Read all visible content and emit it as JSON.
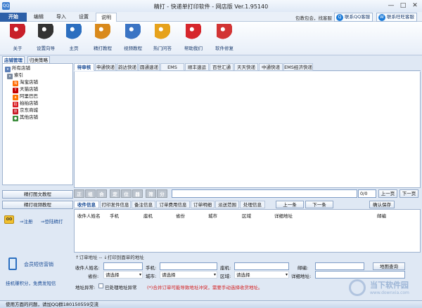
{
  "window": {
    "logo": "QQ",
    "title": "精打 - 快递单打印软件 - 网店版 Ver.1.95140",
    "controls": [
      "—",
      "□",
      "✕"
    ]
  },
  "menu": {
    "start": "开始",
    "tabs": [
      "编辑",
      "导入",
      "设置",
      "说明"
    ],
    "active": "说明"
  },
  "support": {
    "text": "包教包会，找客服",
    "qq_btn": "联系QQ客服",
    "wangwang_btn": "联系旺旺客服"
  },
  "ribbon": [
    {
      "label": "关于",
      "icon": "award-ribbon-icon",
      "color": "#c8202a"
    },
    {
      "label": "设置向导",
      "icon": "top-hat-icon",
      "color": "#333333"
    },
    {
      "label": "主页",
      "icon": "feather-pen-icon",
      "color": "#2c6fc0"
    },
    {
      "label": "精打教程",
      "icon": "document-user-icon",
      "color": "#d98a1c"
    },
    {
      "label": "视频教程",
      "icon": "monitor-video-icon",
      "color": "#3a74c4"
    },
    {
      "label": "热门问答",
      "icon": "speech-bubbles-icon",
      "color": "#e6a21c"
    },
    {
      "label": "帮助我们",
      "icon": "life-ring-icon",
      "color": "#d6262c"
    },
    {
      "label": "软件修复",
      "icon": "first-aid-kit-icon",
      "color": "#d23434"
    }
  ],
  "sidebar": {
    "tabs": [
      "店铺管理",
      "归类策略"
    ],
    "root": "所有店铺",
    "index": "索引",
    "stores": [
      {
        "label": "淘宝店铺",
        "icon": "taobao-icon",
        "color": "#ff6a00",
        "glyph": "淘"
      },
      {
        "label": "天猫店铺",
        "icon": "tmall-icon",
        "color": "#c40000",
        "glyph": "T"
      },
      {
        "label": "阿里巴巴",
        "icon": "alibaba-icon",
        "color": "#ff7300",
        "glyph": "a"
      },
      {
        "label": "拍拍店铺",
        "icon": "paipai-icon",
        "color": "#d8161c",
        "glyph": "拍"
      },
      {
        "label": "京东商城",
        "icon": "jd-icon",
        "color": "#c81623",
        "glyph": "京"
      },
      {
        "label": "其他店铺",
        "icon": "other-store-icon",
        "color": "#3a8c3a",
        "glyph": "●"
      }
    ],
    "btn_tutorial": "精打图文教程",
    "btn_video": "精打视频教程",
    "login_icon": "OO",
    "register": "注册",
    "login": "登陆精打",
    "sms": "会员短信营销",
    "promo": "挂机赚积分，免费发短信"
  },
  "courier_tabs": [
    "待审核",
    "申通快递",
    "韵达快递",
    "圆通速递",
    "EMS",
    "顺丰速运",
    "百世汇通",
    "天天快递",
    "中通快递",
    "EMS经济快递"
  ],
  "toolbar2": {
    "buttons": [
      "正",
      "组",
      "合",
      "定",
      "位",
      "器",
      "筛",
      "分"
    ],
    "page": "0/0",
    "prev": "上一页",
    "next": "下一页"
  },
  "detail": {
    "tabs": [
      "收件信息",
      "打印发件信息",
      "备注信息",
      "订单费用信息",
      "订单明细",
      "派送范围",
      "处理信息"
    ],
    "prev": "上一条",
    "next": "下一条",
    "confirm": "确认保存",
    "columns": [
      "收件人姓名",
      "手机",
      "座机",
      "省份",
      "城市",
      "区域",
      "详细地址",
      "邮编"
    ],
    "hint": "↑订单地址 -- ↓打印到面单的地址",
    "form": {
      "name": "收件人姓名:",
      "mobile": "手机:",
      "phone": "座机:",
      "postcode": "邮编:",
      "map": "地图查询",
      "province": "省份:",
      "city": "城市:",
      "area": "区域:",
      "address": "详细地址:",
      "select": "请选择",
      "abnormal": "地址异常:",
      "processed": "已处理地址异常",
      "warning": "(*)合并订单可能导致地址冲突，需要手动选择收货地址。"
    }
  },
  "statusbar": "使用方面的问题，请加QQ群180150559交流",
  "watermark": {
    "brand": "当下软件园",
    "url": "www.downxia.com"
  }
}
